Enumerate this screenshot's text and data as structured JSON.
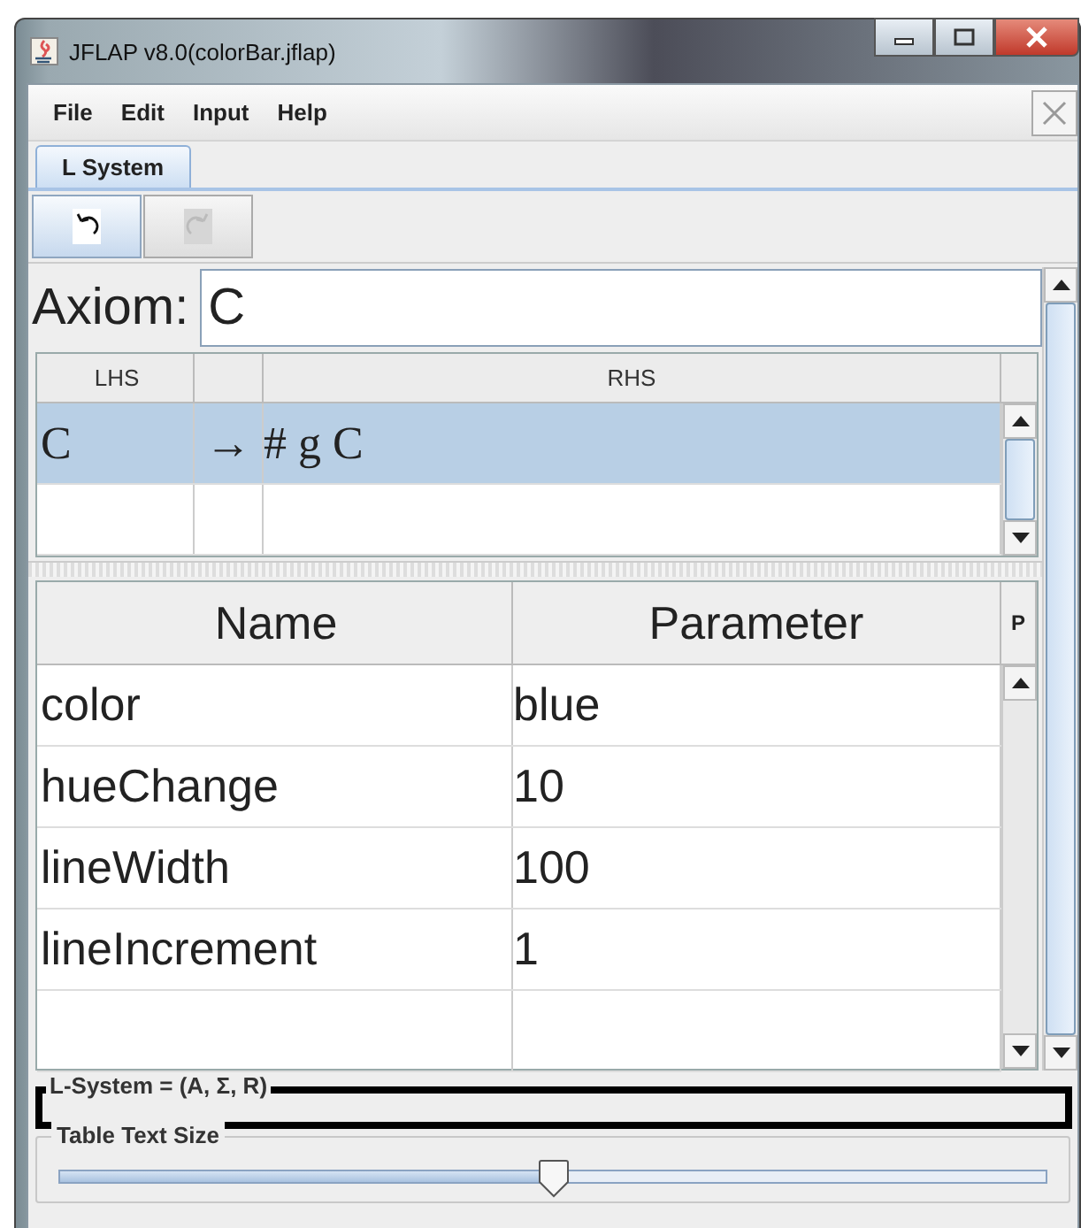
{
  "window": {
    "title": "JFLAP v8.0(colorBar.jflap)"
  },
  "menu": [
    "File",
    "Edit",
    "Input",
    "Help"
  ],
  "tabs": [
    {
      "label": "L System",
      "selected": true
    }
  ],
  "toolbar": [
    {
      "kind": "undo",
      "disabled": false
    },
    {
      "kind": "redo",
      "disabled": true
    }
  ],
  "axiom": {
    "label": "Axiom:",
    "value": "C"
  },
  "rules": {
    "columns": [
      "LHS",
      "RHS"
    ],
    "rows": [
      {
        "lhs": "C",
        "arrow": "→",
        "rhs": "# g C",
        "selected": true
      }
    ]
  },
  "parameters": {
    "columns": [
      "Name",
      "Parameter",
      "P"
    ],
    "rows": [
      {
        "name": "color",
        "value": "blue"
      },
      {
        "name": "hueChange",
        "value": "10"
      },
      {
        "name": "lineWidth",
        "value": "100"
      },
      {
        "name": "lineIncrement",
        "value": "1"
      }
    ]
  },
  "definition_panel": {
    "title": "L-System = (A, Σ, R)"
  },
  "text_size": {
    "title": "Table Text Size",
    "level": 0.5
  }
}
